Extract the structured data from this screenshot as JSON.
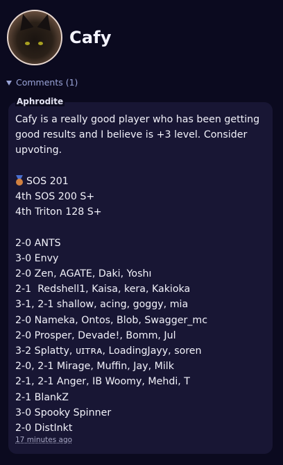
{
  "profile": {
    "username": "Cafy"
  },
  "comments": {
    "toggle_label": "Comments (1)",
    "items": [
      {
        "author": "Aphrodite",
        "intro": "Cafy is a really good player who has been getting good results and I believe is +3 level. Consider upvoting.",
        "placements": [
          "SOS 201",
          "4th SOS 200 S+",
          "4th Triton 128 S+"
        ],
        "results": [
          "2-0 ANTS",
          "3-0 Envy",
          "2-0 Zen, AGATE, Daki, Yoshı",
          "2-1  Redshell1, Kaisa, kera, Kakioka",
          "3-1, 2-1 shallow, acing, goggy, mia",
          "2-0 Nameka, Ontos, Blob, Swagger_mc",
          "2-0 Prosper, Devade!, Bomm, Jul",
          "3-2 Splatty, ᴜɪᴛʀᴀ, LoadingJayy, soren",
          "2-0, 2-1 Mirage, Muffin, Jay, Milk",
          "2-1, 2-1 Anger, IB Woomy, Mehdi, T",
          "2-1 BlankZ",
          "3-0 Spooky Spinner",
          "2-0 DistInkt"
        ],
        "timestamp": "17 minutes ago"
      }
    ]
  },
  "colors": {
    "background": "#0b0a1f",
    "card": "#181634",
    "accent": "#9aa4d8",
    "medal": "bronze"
  }
}
